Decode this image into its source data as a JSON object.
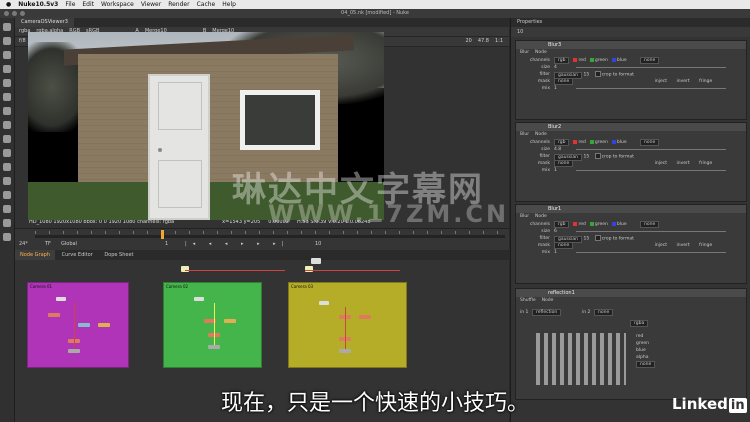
{
  "menubar": {
    "app": "Nuke10.5v3",
    "items": [
      "File",
      "Edit",
      "Workspace",
      "Viewer",
      "Render",
      "Cache",
      "Help"
    ]
  },
  "window": {
    "title": "04_05.nk [modified] - Nuke"
  },
  "viewer": {
    "tab": "CameraOSViewer3",
    "channels": "rgba",
    "alpha": "rgba.alpha",
    "colorspace": "RGB",
    "lut": "sRGB",
    "input_a": "A",
    "input_a_node": "Merge10",
    "input_b": "B",
    "input_b_node": "Merge10",
    "frame_label": "f/8",
    "frame_value": "1",
    "zoom": "47.8",
    "ratio": "1:1",
    "gain": "20",
    "status": "HD_1080 1920x1080  bbox: 0 0 1920 1080 channels: rgba",
    "coords": "x=1543 y=205",
    "pixel": "0.00002",
    "hsv": "H:53 S:0.39 V:0.20  L:0.06248",
    "res_label": "1920,1080"
  },
  "timeline": {
    "fps": "24*",
    "tf": "TF",
    "range": "Global",
    "frame": "1",
    "end": "10"
  },
  "nodegraph": {
    "tabs": [
      "Node Graph",
      "Curve Editor",
      "Dope Sheet"
    ],
    "backdrops": [
      {
        "label": "Camera 01",
        "color": "#b034b8"
      },
      {
        "label": "Camera 02",
        "color": "#43b54a"
      },
      {
        "label": "Camera 03",
        "color": "#b5ad28"
      }
    ]
  },
  "properties": {
    "title": "Properties",
    "count": "10",
    "nodes": [
      {
        "name": "Blur3",
        "tabs": [
          "Blur",
          "Node"
        ],
        "channels": "rgb",
        "red": "red",
        "green": "green",
        "blue": "blue",
        "other": "none",
        "size_label": "size",
        "size": "4",
        "filter_label": "filter",
        "filter": "gaussian",
        "quality": "15",
        "crop": "crop to format",
        "mask_label": "mask",
        "mask": "none",
        "inject": "inject",
        "invert": "invert",
        "fringe": "fringe",
        "mix_label": "mix",
        "mix": "1"
      },
      {
        "name": "Blur2",
        "tabs": [
          "Blur",
          "Node"
        ],
        "channels": "rgb",
        "red": "red",
        "green": "green",
        "blue": "blue",
        "other": "none",
        "size_label": "size",
        "size": "4.8",
        "filter_label": "filter",
        "filter": "gaussian",
        "quality": "15",
        "crop": "crop to format",
        "mask_label": "mask",
        "mask": "none",
        "inject": "inject",
        "invert": "invert",
        "fringe": "fringe",
        "mix_label": "mix",
        "mix": "1"
      },
      {
        "name": "Blur1",
        "tabs": [
          "Blur",
          "Node"
        ],
        "channels": "rgb",
        "red": "red",
        "green": "green",
        "blue": "blue",
        "other": "none",
        "size_label": "size",
        "size": "6",
        "filter_label": "filter",
        "filter": "gaussian",
        "quality": "15",
        "crop": "crop to format",
        "mask_label": "mask",
        "mask": "none",
        "inject": "inject",
        "invert": "invert",
        "fringe": "fringe",
        "mix_label": "mix",
        "mix": "1"
      }
    ],
    "shuffle": {
      "name": "reflection1",
      "tabs": [
        "Shuffle",
        "Node"
      ],
      "in1": "in 1",
      "in1_val": "reflection",
      "in2": "in 2",
      "in2_val": "none",
      "out": "rgba",
      "outputs": [
        "red",
        "green",
        "blue",
        "alpha"
      ],
      "out2": "none"
    }
  },
  "overlay": {
    "subtitle": "现在，只是一个快速的小技巧。",
    "watermark": "琳达中文字幕网",
    "watermark2": "WWW.17ZM.CN",
    "brand": "Linked",
    "brand_in": "in"
  }
}
